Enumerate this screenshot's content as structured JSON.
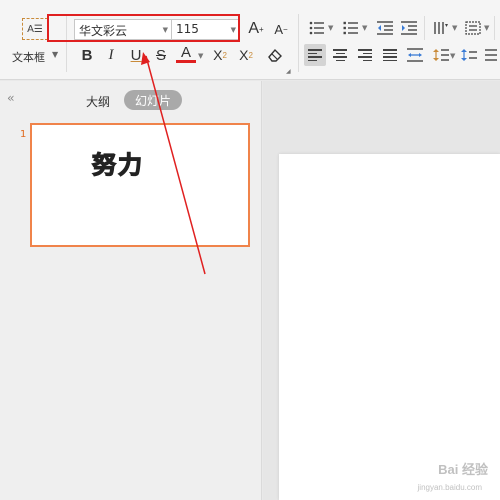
{
  "ribbon": {
    "textbox_label": "文本框",
    "font_name": "华文彩云",
    "font_size": "115",
    "bold_label": "B",
    "italic_label": "I",
    "underline_label": "U",
    "strike_label": "S",
    "font_color_label": "A",
    "superscript_label": "X",
    "superscript_mark": "2",
    "subscript_label": "X",
    "subscript_mark": "2",
    "grow_font_label": "A",
    "shrink_font_label": "A"
  },
  "panel": {
    "tab_outline": "大纲",
    "tab_slides": "幻灯片",
    "slide_number": "1",
    "slide_text": "努力"
  },
  "watermark": {
    "text": "Bai 经验",
    "sub": "jingyan.baidu.com"
  },
  "colors": {
    "highlight": "#e02020",
    "accent_orange": "#f0834a",
    "font_color_bar": "#e02020"
  }
}
